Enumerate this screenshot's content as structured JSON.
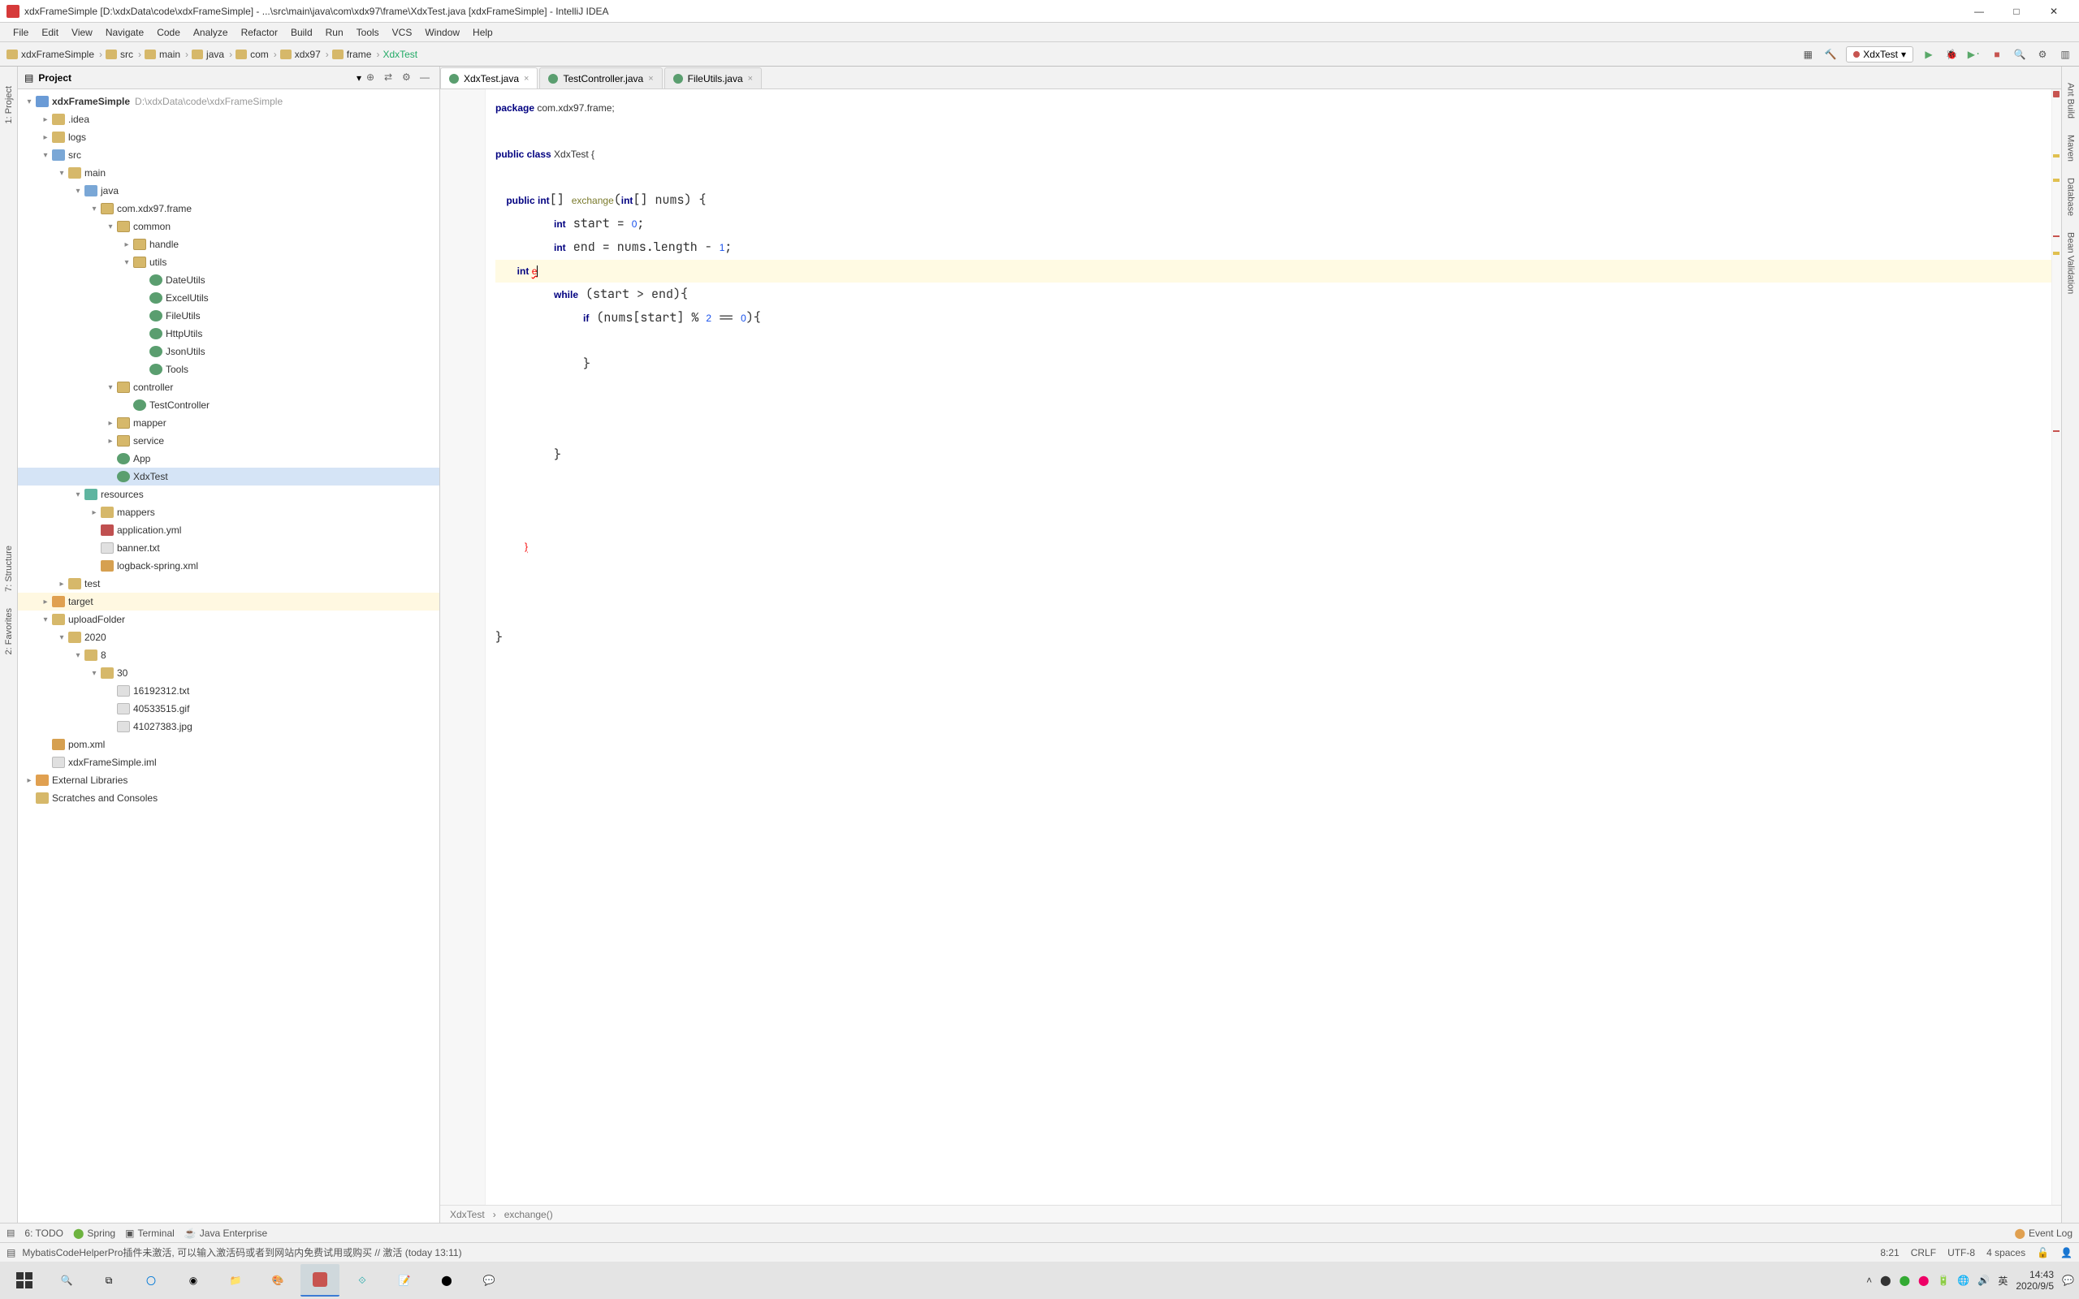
{
  "window": {
    "title": "xdxFrameSimple [D:\\xdxData\\code\\xdxFrameSimple] - ...\\src\\main\\java\\com\\xdx97\\frame\\XdxTest.java [xdxFrameSimple] - IntelliJ IDEA"
  },
  "menu": [
    "File",
    "Edit",
    "View",
    "Navigate",
    "Code",
    "Analyze",
    "Refactor",
    "Build",
    "Run",
    "Tools",
    "VCS",
    "Window",
    "Help"
  ],
  "breadcrumbs": [
    "xdxFrameSimple",
    "src",
    "main",
    "java",
    "com",
    "xdx97",
    "frame",
    "XdxTest"
  ],
  "run_config": {
    "name": "XdxTest"
  },
  "project_header": {
    "title": "Project"
  },
  "tree": {
    "root": {
      "name": "xdxFrameSimple",
      "hint": "D:\\xdxData\\code\\xdxFrameSimple"
    },
    "idea": ".idea",
    "logs": "logs",
    "src": "src",
    "main": "main",
    "java": "java",
    "pkg": "com.xdx97.frame",
    "common": "common",
    "handle": "handle",
    "utils": "utils",
    "dateutils": "DateUtils",
    "excelutils": "ExcelUtils",
    "fileutils": "FileUtils",
    "httputils": "HttpUtils",
    "jsonutils": "JsonUtils",
    "tools": "Tools",
    "controller": "controller",
    "testcontroller": "TestController",
    "mapper": "mapper",
    "service": "service",
    "app": "App",
    "xdxtest": "XdxTest",
    "resources": "resources",
    "mappers": "mappers",
    "appyml": "application.yml",
    "banner": "banner.txt",
    "logback": "logback-spring.xml",
    "test": "test",
    "target": "target",
    "uploadfolder": "uploadFolder",
    "y2020": "2020",
    "m8": "8",
    "d30": "30",
    "f1": "16192312.txt",
    "f2": "40533515.gif",
    "f3": "41027383.jpg",
    "pom": "pom.xml",
    "iml": "xdxFrameSimple.iml",
    "extlib": "External Libraries",
    "scratches": "Scratches and Consoles"
  },
  "tabs": [
    {
      "label": "XdxTest.java",
      "active": true
    },
    {
      "label": "TestController.java",
      "active": false
    },
    {
      "label": "FileUtils.java",
      "active": false
    }
  ],
  "code": {
    "l1_kw": "package",
    "l1_rest": " com.xdx97.frame;",
    "l3_a": "public class ",
    "l3_cls": "XdxTest",
    "l3_b": " {",
    "l5_a": "    public int[] ",
    "l5_m": "exchange",
    "l5_b": "(int[] nums) {",
    "l6_a": "        int start = ",
    "l6_n": "0",
    "l6_b": ";",
    "l7_a": "        int end = nums.length - ",
    "l7_n": "1",
    "l7_b": ";",
    "l8_a": "        int ",
    "l8_err": "e",
    "l9_a": "        while (start > end){",
    "l10_a": "            if (nums[start] % ",
    "l10_n1": "2",
    "l10_b": " == ",
    "l10_n2": "0",
    "l10_c": "){",
    "l12_a": "            }",
    "l16_a": "        }",
    "l20_a": "    }",
    "l24_a": "}"
  },
  "editor_path": {
    "cls": "XdxTest",
    "method": "exchange()"
  },
  "bottom_tools": {
    "todo": "6: TODO",
    "spring": "Spring",
    "terminal": "Terminal",
    "javaee": "Java Enterprise",
    "eventlog": "Event Log"
  },
  "status": {
    "msg": "MybatisCodeHelperPro插件未激活, 可以输入激活码或者到网站内免费试用或购买 // 激活 (today 13:11)",
    "pos": "8:21",
    "le": "CRLF",
    "enc": "UTF-8",
    "indent": "4 spaces"
  },
  "right_tools": [
    "Ant Build",
    "Maven",
    "Database",
    "Bean Validation"
  ],
  "left_tools": {
    "project": "1: Project",
    "structure": "7: Structure",
    "favorites": "2: Favorites"
  },
  "system": {
    "ime": "英",
    "time": "14:43",
    "date": "2020/9/5"
  }
}
